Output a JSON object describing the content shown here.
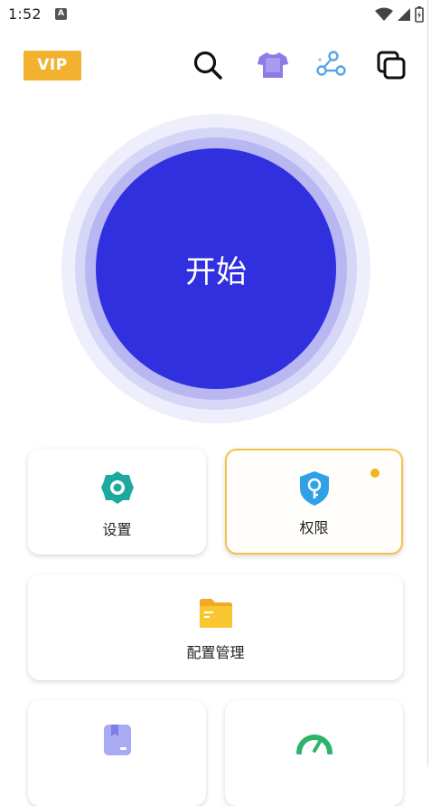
{
  "status_bar": {
    "time": "1:52",
    "notification_icon": "A"
  },
  "header": {
    "vip_label": "VIP",
    "icons": [
      "search-icon",
      "theme-shirt-icon",
      "share-icon",
      "copy-icon"
    ]
  },
  "start_button": {
    "label": "开始"
  },
  "cards": {
    "settings": {
      "label": "设置",
      "icon": "gear-icon",
      "color": "#1ba9a0"
    },
    "permissions": {
      "label": "权限",
      "icon": "shield-key-icon",
      "color": "#2fa1e6",
      "has_notification_dot": true
    },
    "config_management": {
      "label": "配置管理",
      "icon": "folder-icon",
      "color": "#f7c02b"
    },
    "bottom_left": {
      "label": "",
      "icon": "bookmark-book-icon",
      "color": "#a9aaf4"
    },
    "bottom_right": {
      "label": "",
      "icon": "speedometer-icon",
      "color": "#2db36a"
    }
  },
  "colors": {
    "accent": "#3030df",
    "vip": "#f2b230",
    "highlight_border": "#f3c34d"
  }
}
